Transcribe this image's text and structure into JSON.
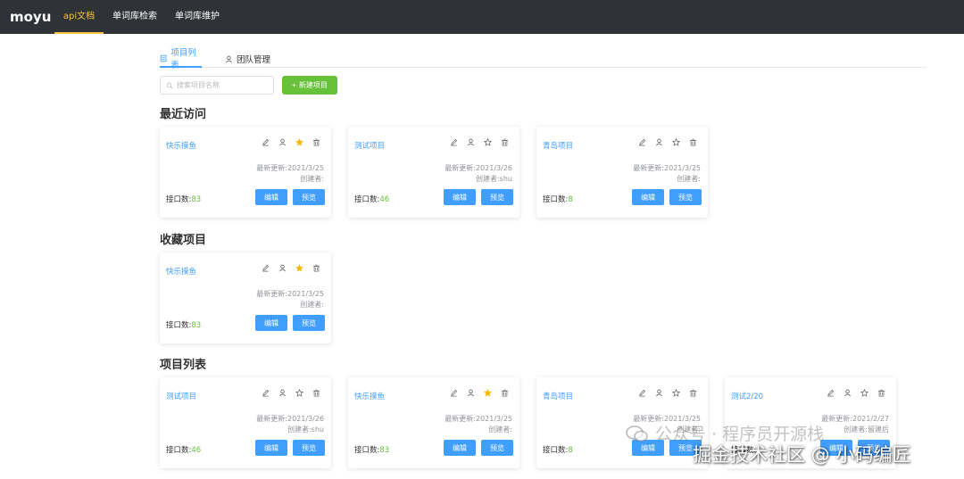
{
  "app": {
    "logo": "moyu"
  },
  "nav": [
    {
      "label": "api文档",
      "active": true
    },
    {
      "label": "单词库检索",
      "active": false
    },
    {
      "label": "单词库维护",
      "active": false
    }
  ],
  "tabs": [
    {
      "label": "项目列表",
      "active": true
    },
    {
      "label": "团队管理",
      "active": false
    }
  ],
  "search": {
    "placeholder": "搜索项目名称",
    "value": ""
  },
  "new_button": {
    "label": "新建项目"
  },
  "sections": {
    "recent": {
      "title": "最近访问"
    },
    "favorite": {
      "title": "收藏项目"
    },
    "all": {
      "title": "项目列表"
    }
  },
  "card_labels": {
    "edit": "编辑",
    "preview": "预览",
    "count_label": "接口数:"
  },
  "recent_cards": [
    {
      "name": "快乐摸鱼",
      "updated": "最新更新:2021/3/25",
      "creator": "创建者:",
      "count": "83",
      "starred": true
    },
    {
      "name": "测试项目",
      "updated": "最新更新:2021/3/26",
      "creator": "创建者:shu",
      "count": "46",
      "starred": false
    },
    {
      "name": "青岛项目",
      "updated": "最新更新:2021/3/25",
      "creator": "创建者:",
      "count": "8",
      "starred": false
    }
  ],
  "favorite_cards": [
    {
      "name": "快乐摸鱼",
      "updated": "最新更新:2021/3/25",
      "creator": "创建者:",
      "count": "83",
      "starred": true
    }
  ],
  "all_cards": [
    {
      "name": "测试项目",
      "updated": "最新更新:2021/3/26",
      "creator": "创建者:shu",
      "count": "46",
      "starred": false
    },
    {
      "name": "快乐摸鱼",
      "updated": "最新更新:2021/3/25",
      "creator": "创建者:",
      "count": "83",
      "starred": true
    },
    {
      "name": "青岛项目",
      "updated": "最新更新:2021/3/25",
      "creator": "创建者:",
      "count": "8",
      "starred": false
    },
    {
      "name": "测试2/20",
      "updated": "最新更新:2021/2/27",
      "creator": "创建者:留建后",
      "count": "",
      "starred": false
    }
  ],
  "watermark": {
    "line1": "公众号 · 程序员开源栈",
    "line2": "掘金技术社区 @ 小码编匠"
  },
  "colors": {
    "topbar": "#2f3337",
    "accent": "#409eff",
    "success": "#67c23a",
    "star": "#f5b800",
    "nav_active": "#f5c242"
  }
}
